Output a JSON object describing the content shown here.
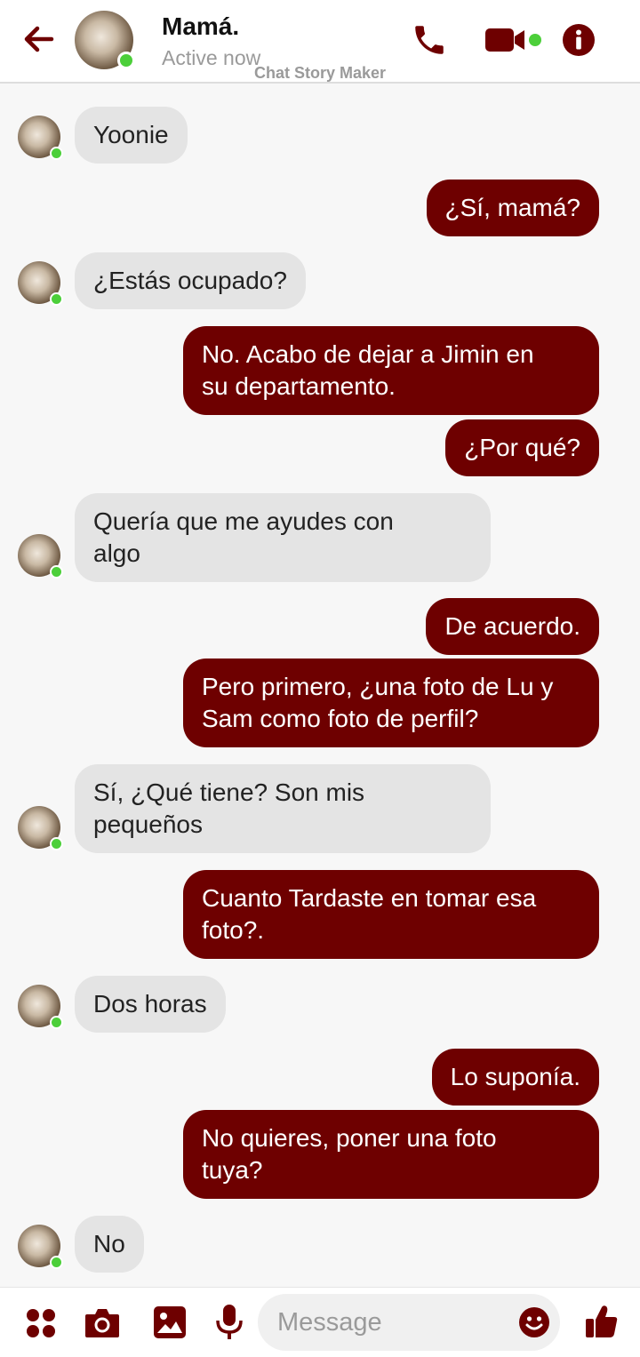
{
  "header": {
    "name": "Mamá.",
    "status": "Active now",
    "watermark": "Chat Story Maker"
  },
  "theme": {
    "accent": "#6e0000",
    "incoming_bubble": "#e4e4e4",
    "online": "#4ccf3a"
  },
  "icons": {
    "back": "arrow-left-icon",
    "call": "phone-icon",
    "video": "video-camera-icon",
    "info": "info-icon",
    "apps": "four-dots-icon",
    "camera": "camera-icon",
    "gallery": "image-icon",
    "mic": "microphone-icon",
    "emoji": "smiley-icon",
    "like": "thumbs-up-icon"
  },
  "messages": [
    {
      "dir": "in",
      "lines": [
        "Yoonie"
      ]
    },
    {
      "dir": "out",
      "lines": [
        "¿Sí, mamá?"
      ]
    },
    {
      "dir": "in",
      "lines": [
        "¿Estás ocupado?"
      ]
    },
    {
      "dir": "out",
      "lines": [
        "No. Acabo de dejar a Jimin en",
        "su departamento."
      ]
    },
    {
      "dir": "out",
      "lines": [
        "¿Por qué?"
      ]
    },
    {
      "dir": "in",
      "lines": [
        "Quería que me ayudes con",
        "algo"
      ]
    },
    {
      "dir": "out",
      "lines": [
        "De acuerdo."
      ]
    },
    {
      "dir": "out",
      "lines": [
        "Pero primero, ¿una foto de Lu y",
        "Sam como foto de perfil?"
      ]
    },
    {
      "dir": "in",
      "lines": [
        "Sí, ¿Qué tiene? Son mis",
        "pequeños"
      ]
    },
    {
      "dir": "out",
      "lines": [
        "Cuanto Tardaste en tomar esa",
        "foto?."
      ]
    },
    {
      "dir": "in",
      "lines": [
        "Dos horas"
      ]
    },
    {
      "dir": "out",
      "lines": [
        "Lo suponía."
      ]
    },
    {
      "dir": "out",
      "lines": [
        "No quieres, poner una foto",
        "tuya?"
      ]
    },
    {
      "dir": "in",
      "lines": [
        "No"
      ]
    }
  ],
  "composer": {
    "placeholder": "Message"
  }
}
